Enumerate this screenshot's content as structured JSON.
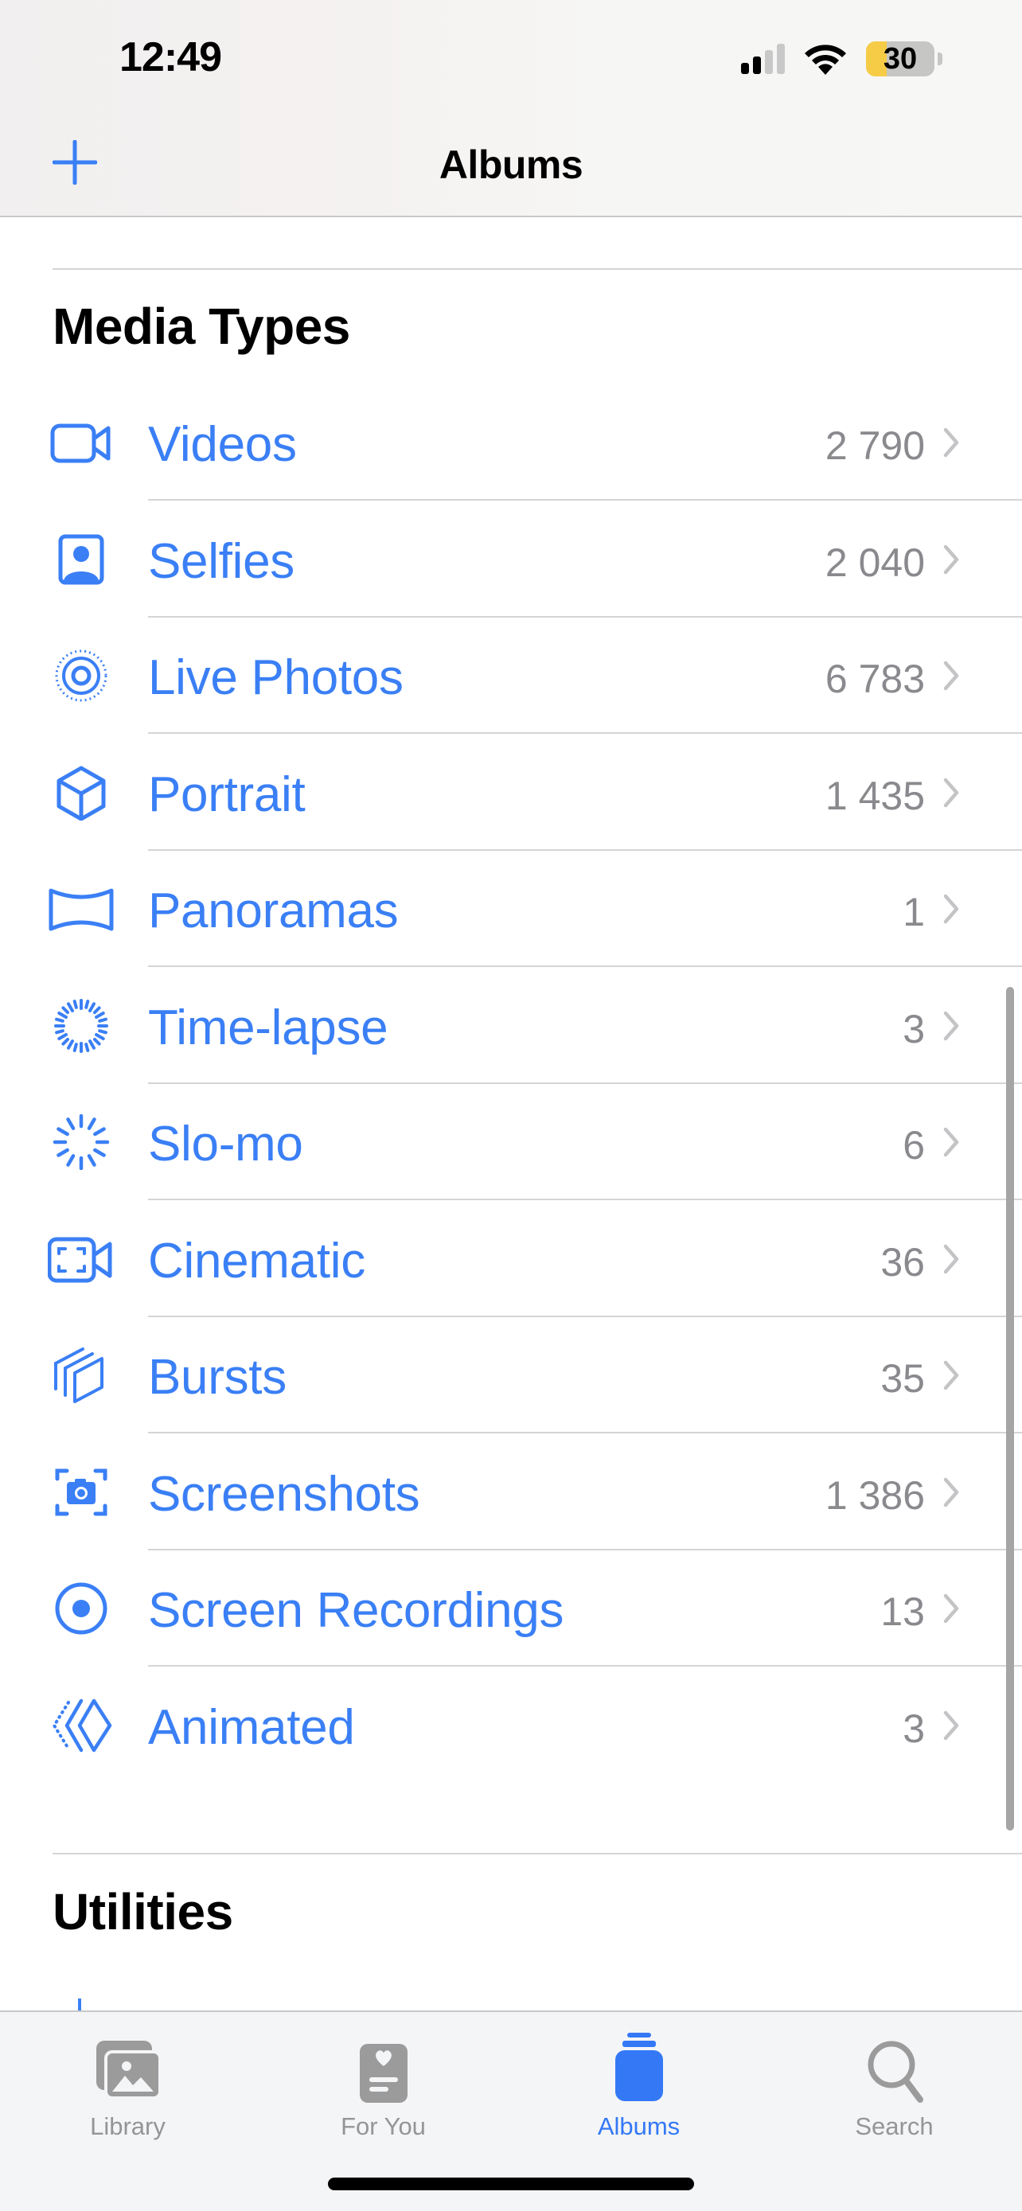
{
  "status_bar": {
    "time": "12:49",
    "signal_bars_active": 2,
    "signal_bars_total": 4,
    "battery_percent": 30,
    "battery_label": "30",
    "battery_color": "#f6cc46",
    "icons": [
      "signal-icon",
      "wifi-icon",
      "battery-icon"
    ]
  },
  "nav": {
    "title": "Albums",
    "add_icon": "plus-icon"
  },
  "colors": {
    "accent": "#3a7ff5",
    "count_gray": "#8a8a8e",
    "separator": "#d5d5d7",
    "tab_inactive": "#959595"
  },
  "sections": [
    {
      "title": "Media Types",
      "items": [
        {
          "label": "Videos",
          "count": "2 790",
          "icon": "video-camera-icon"
        },
        {
          "label": "Selfies",
          "count": "2 040",
          "icon": "selfie-person-icon"
        },
        {
          "label": "Live Photos",
          "count": "6 783",
          "icon": "live-photo-icon"
        },
        {
          "label": "Portrait",
          "count": "1 435",
          "icon": "cube-icon"
        },
        {
          "label": "Panoramas",
          "count": "1",
          "icon": "panorama-icon"
        },
        {
          "label": "Time-lapse",
          "count": "3",
          "icon": "timelapse-icon"
        },
        {
          "label": "Slo-mo",
          "count": "6",
          "icon": "slomo-icon"
        },
        {
          "label": "Cinematic",
          "count": "36",
          "icon": "cinematic-camera-icon"
        },
        {
          "label": "Bursts",
          "count": "35",
          "icon": "bursts-stack-icon"
        },
        {
          "label": "Screenshots",
          "count": "1 386",
          "icon": "screenshot-camera-icon"
        },
        {
          "label": "Screen Recordings",
          "count": "13",
          "icon": "screen-record-icon"
        },
        {
          "label": "Animated",
          "count": "3",
          "icon": "animated-diamond-icon"
        }
      ]
    },
    {
      "title": "Utilities",
      "items": []
    }
  ],
  "tabbar": {
    "tabs": [
      {
        "label": "Library",
        "icon": "photo-library-icon",
        "active": false
      },
      {
        "label": "For You",
        "icon": "for-you-heart-icon",
        "active": false
      },
      {
        "label": "Albums",
        "icon": "albums-stack-icon",
        "active": true
      },
      {
        "label": "Search",
        "icon": "magnifier-icon",
        "active": false
      }
    ]
  }
}
